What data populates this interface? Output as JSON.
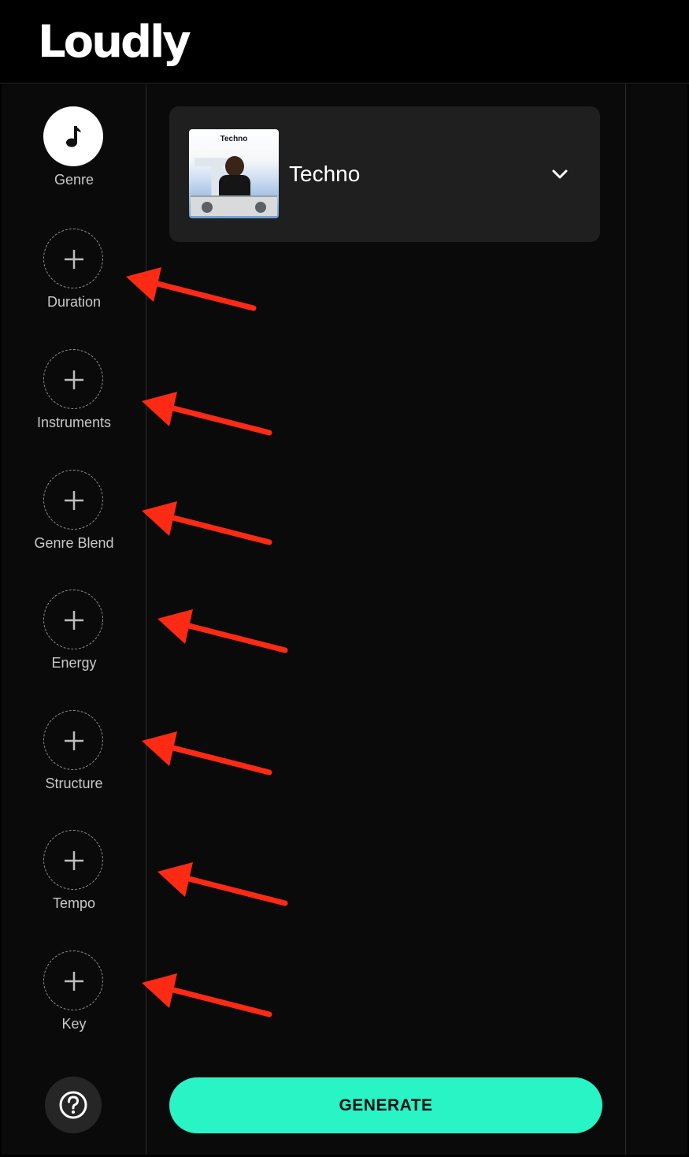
{
  "brand": {
    "name": "Loudly"
  },
  "sidebar": {
    "items": [
      {
        "label": "Genre",
        "icon": "music-note-icon",
        "active": true
      },
      {
        "label": "Duration",
        "icon": "plus-icon",
        "active": false
      },
      {
        "label": "Instruments",
        "icon": "plus-icon",
        "active": false
      },
      {
        "label": "Genre Blend",
        "icon": "plus-icon",
        "active": false
      },
      {
        "label": "Energy",
        "icon": "plus-icon",
        "active": false
      },
      {
        "label": "Structure",
        "icon": "plus-icon",
        "active": false
      },
      {
        "label": "Tempo",
        "icon": "plus-icon",
        "active": false
      },
      {
        "label": "Key",
        "icon": "plus-icon",
        "active": false
      }
    ],
    "help_icon": "help-icon"
  },
  "genre_selector": {
    "selected": "Techno",
    "thumbnail_label": "Techno",
    "thumbnail_letter": "T"
  },
  "actions": {
    "generate_label": "GENERATE"
  },
  "colors": {
    "accent": "#28f4c6",
    "annotation_arrow": "#ff2a14",
    "background": "#0a0a0a",
    "card": "#1f1f1f"
  }
}
